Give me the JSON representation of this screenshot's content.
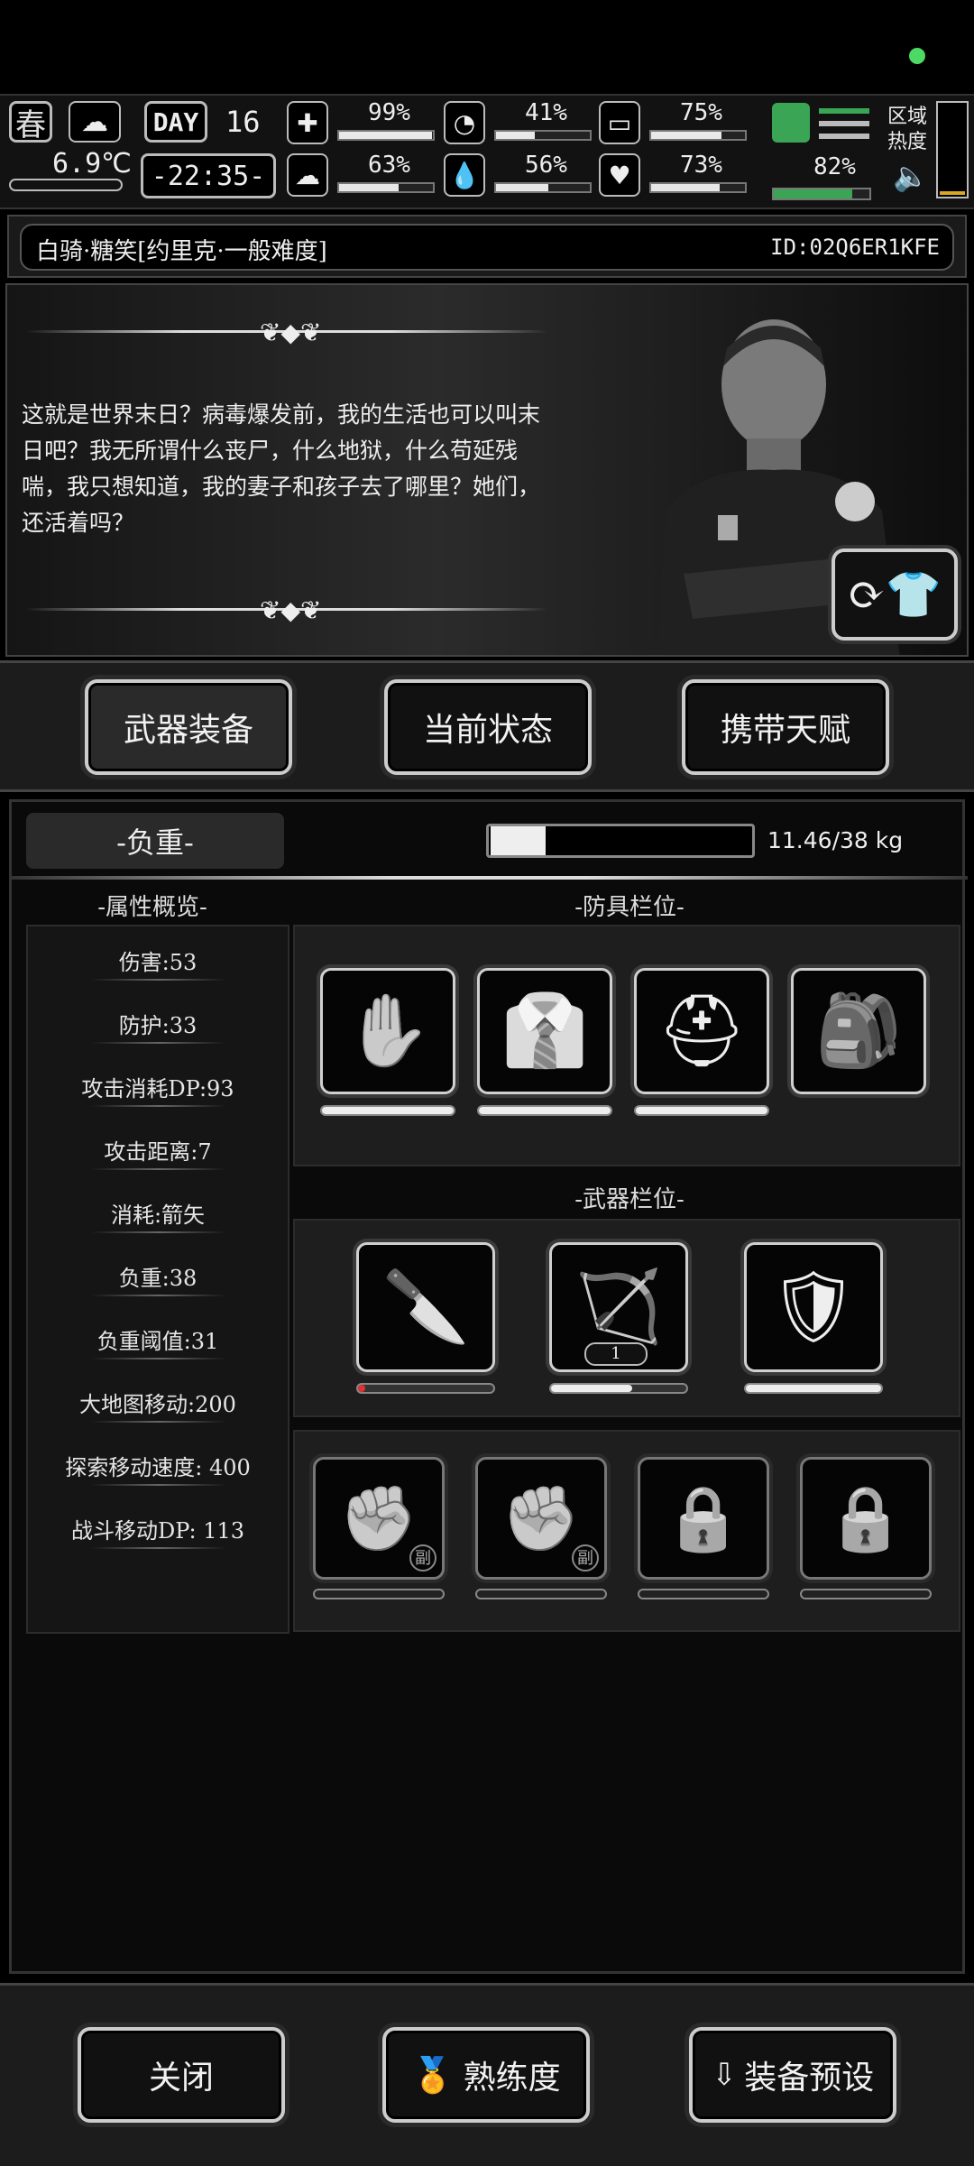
{
  "hud": {
    "season": "春",
    "temperature": "6.9℃",
    "day_label": "DAY",
    "day_number": "16",
    "time": "-22:35-",
    "stats": [
      {
        "name": "health",
        "value": "99%",
        "level": 0.99
      },
      {
        "name": "stomach",
        "value": "41%",
        "level": 0.41
      },
      {
        "name": "stamina",
        "value": "75%",
        "level": 0.75
      },
      {
        "name": "brain",
        "value": "63%",
        "level": 0.63
      },
      {
        "name": "water",
        "value": "56%",
        "level": 0.56
      },
      {
        "name": "heart",
        "value": "73%",
        "level": 0.73
      }
    ],
    "energy_value": "82%",
    "energy_level": 0.82,
    "zone_heat_label": "区域热度"
  },
  "profile": {
    "name": "白骑·糖笑[约里克·一般难度]",
    "id": "ID:02Q6ER1KFE"
  },
  "story": {
    "text": "这就是世界末日？病毒爆发前，我的生活也可以叫末日吧？我无所谓什么丧尸，什么地狱，什么苟延残喘，我只想知道，我的妻子和孩子去了哪里？她们，还活着吗？"
  },
  "tabs": [
    {
      "label": "武器装备"
    },
    {
      "label": "当前状态"
    },
    {
      "label": "携带天赋"
    }
  ],
  "weight": {
    "label": "-负重-",
    "value_text": "11.46/38 kg",
    "level": 0.3
  },
  "attributes": {
    "title": "-属性概览-",
    "items": [
      "伤害:53",
      "防护:33",
      "攻击消耗DP:93",
      "攻击距离:7",
      "消耗:箭矢",
      "负重:38",
      "负重阈值:31",
      "大地图移动:200",
      "探索移动速度: 400",
      "战斗移动DP: 113"
    ]
  },
  "armor": {
    "title": "-防具栏位-",
    "slots": [
      {
        "icon": "gloves-icon",
        "durability": 1.0
      },
      {
        "icon": "clothes-icon",
        "durability": 1.0
      },
      {
        "icon": "helmet-icon",
        "durability": 1.0
      },
      {
        "icon": "backpack-icon",
        "durability": null
      }
    ]
  },
  "weapons": {
    "title": "-武器栏位-",
    "slots": [
      {
        "icon": "knife-icon",
        "durability": 0.05
      },
      {
        "icon": "crossbow-icon",
        "durability": 0.6,
        "ammo": "1"
      },
      {
        "icon": "shield-icon",
        "durability": 1.0
      }
    ],
    "secondary_badge": "副"
  },
  "bottom": {
    "close": "关闭",
    "proficiency": "熟练度",
    "preset": "装备预设"
  }
}
